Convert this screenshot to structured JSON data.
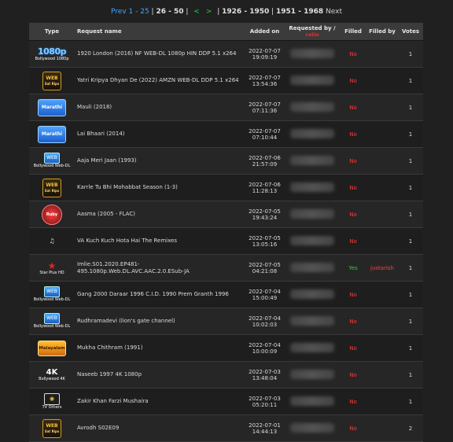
{
  "pager": {
    "prev": "Prev",
    "p1": "1 - 25",
    "p2": "26 - 50",
    "left_arrow": "<",
    "right_arrow": ">",
    "r1": "1926 - 1950",
    "r2": "1951 - 1968",
    "next": "Next"
  },
  "columns": {
    "type": "Type",
    "name": "Request name",
    "date": "Added on",
    "req": "Requested by /",
    "ratio": "ratio",
    "filled": "Filled",
    "filledby": "Filled by",
    "votes": "Votes"
  },
  "rows": [
    {
      "badge": "1080p",
      "badge_sub": "Bollywood 1080p",
      "name": "1920 London (2016) NF WEB-DL 1080p HIN DDP 5.1 x264",
      "date": "2022-07-07",
      "time": "19:09:19",
      "filled": "No",
      "filled_by": "",
      "votes": "1"
    },
    {
      "badge": "WEB",
      "badge_sub": "Sat Rips",
      "name": "Yatri Kripya Dhyan De (2022) AMZN WEB-DL DDP 5.1 x264",
      "date": "2022-07-07",
      "time": "13:54:36",
      "filled": "No",
      "filled_by": "",
      "votes": "1"
    },
    {
      "badge": "Marathi",
      "badge_sub": "",
      "name": "Mauli (2018)",
      "date": "2022-07-07",
      "time": "07:11:36",
      "filled": "No",
      "filled_by": "",
      "votes": "1"
    },
    {
      "badge": "Marathi",
      "badge_sub": "",
      "name": "Lai Bhaari (2014)",
      "date": "2022-07-07",
      "time": "07:10:44",
      "filled": "No",
      "filled_by": "",
      "votes": "1"
    },
    {
      "badge": "WEB",
      "badge_sub": "Bollywood Web-DL",
      "name": "Aaja Meri Jaan (1993)",
      "date": "2022-07-06",
      "time": "21:57:09",
      "filled": "No",
      "filled_by": "",
      "votes": "1"
    },
    {
      "badge": "WEB",
      "badge_sub": "Sat Rips",
      "name": "Karrle Tu Bhi Mohabbat Season (1-3)",
      "date": "2022-07-06",
      "time": "11:28:13",
      "filled": "No",
      "filled_by": "",
      "votes": "1"
    },
    {
      "badge": "Ruby",
      "badge_sub": "",
      "name": "Aasma (2005 - FLAC)",
      "date": "2022-07-05",
      "time": "19:43:24",
      "filled": "No",
      "filled_by": "",
      "votes": "1"
    },
    {
      "badge": "VA",
      "badge_sub": "",
      "name": "VA     Kuch Kuch Hota Hai The Remixes",
      "date": "2022-07-05",
      "time": "13:05:16",
      "filled": "No",
      "filled_by": "",
      "votes": "1"
    },
    {
      "badge": "Star",
      "badge_sub": "Star Plus HD",
      "name": "Imlie.S01.2020.EP481-495.1080p.Web.DL.AVC.AAC.2.0.ESub-JA",
      "date": "2022-07-05",
      "time": "04:21:08",
      "filled": "Yes",
      "filled_by": "justarish",
      "votes": "1"
    },
    {
      "badge": "WEB",
      "badge_sub": "Bollywood Web-DL",
      "name": "Gang 2000 Daraar 1996 C.I.D. 1990 Prem Granth 1996",
      "date": "2022-07-04",
      "time": "15:00:49",
      "filled": "No",
      "filled_by": "",
      "votes": "1"
    },
    {
      "badge": "WEB",
      "badge_sub": "Bollywood Web-DL",
      "name": "Rudhramadevi (lion's gate channel)",
      "date": "2022-07-04",
      "time": "10:02:03",
      "filled": "No",
      "filled_by": "",
      "votes": "1"
    },
    {
      "badge": "Malayalam",
      "badge_sub": "",
      "name": "Mukha Chithram (1991)",
      "date": "2022-07-04",
      "time": "10:00:09",
      "filled": "No",
      "filled_by": "",
      "votes": "1"
    },
    {
      "badge": "4K",
      "badge_sub": "Bollywood 4K",
      "name": "Naseeb 1997 4K 1080p",
      "date": "2022-07-03",
      "time": "13:48:04",
      "filled": "No",
      "filled_by": "",
      "votes": "1"
    },
    {
      "badge": "TV",
      "badge_sub": "TV Others",
      "name": "Zakir Khan Farzi Mushaira",
      "date": "2022-07-03",
      "time": "05:20:11",
      "filled": "No",
      "filled_by": "",
      "votes": "1"
    },
    {
      "badge": "WEB",
      "badge_sub": "Sat Rips",
      "name": "Avrodh   S02E09",
      "date": "2022-07-01",
      "time": "14:44:13",
      "filled": "No",
      "filled_by": "",
      "votes": "2"
    }
  ]
}
